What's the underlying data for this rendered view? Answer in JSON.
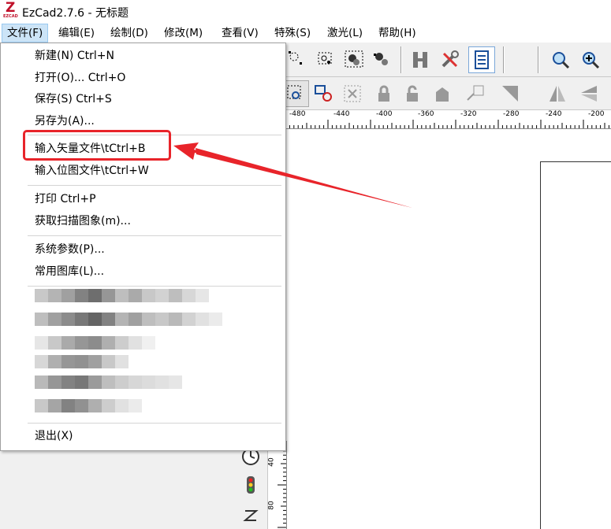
{
  "window": {
    "logo_text": "Z",
    "logo_subtext": "EZCAD",
    "title": "EzCad2.7.6 - 无标题"
  },
  "menu": {
    "items": [
      {
        "label": "文件(F)"
      },
      {
        "label": "编辑(E)"
      },
      {
        "label": "绘制(D)"
      },
      {
        "label": "修改(M)"
      },
      {
        "label": "查看(V)"
      },
      {
        "label": "特殊(S)"
      },
      {
        "label": "激光(L)"
      },
      {
        "label": "帮助(H)"
      }
    ],
    "active_index": 0
  },
  "file_menu": {
    "items": [
      {
        "label": "新建(N) Ctrl+N"
      },
      {
        "label": "打开(O)... Ctrl+O"
      },
      {
        "label": "保存(S) Ctrl+S"
      },
      {
        "label": "另存为(A)..."
      },
      {
        "label": "输入矢量文件\\tCtrl+B",
        "highlighted": true
      },
      {
        "label": "输入位图文件\\tCtrl+W"
      },
      {
        "label": "打印 Ctrl+P"
      },
      {
        "label": "获取扫描图象(m)..."
      },
      {
        "label": "系统参数(P)..."
      },
      {
        "label": "常用图库(L)..."
      },
      {
        "label": "退出(X)"
      }
    ],
    "recent_files_blurred": true
  },
  "ruler": {
    "horizontal_labels": [
      "-480",
      "-440",
      "-400",
      "-360",
      "-320",
      "-280",
      "-240",
      "-200"
    ],
    "vertical_labels": [
      "40",
      "80"
    ]
  },
  "annotation": {
    "color": "#e8242a"
  },
  "colors": {
    "menu_active_bg": "#cce4f7",
    "highlight": "#e8242a",
    "canvas": "#ffffff"
  }
}
